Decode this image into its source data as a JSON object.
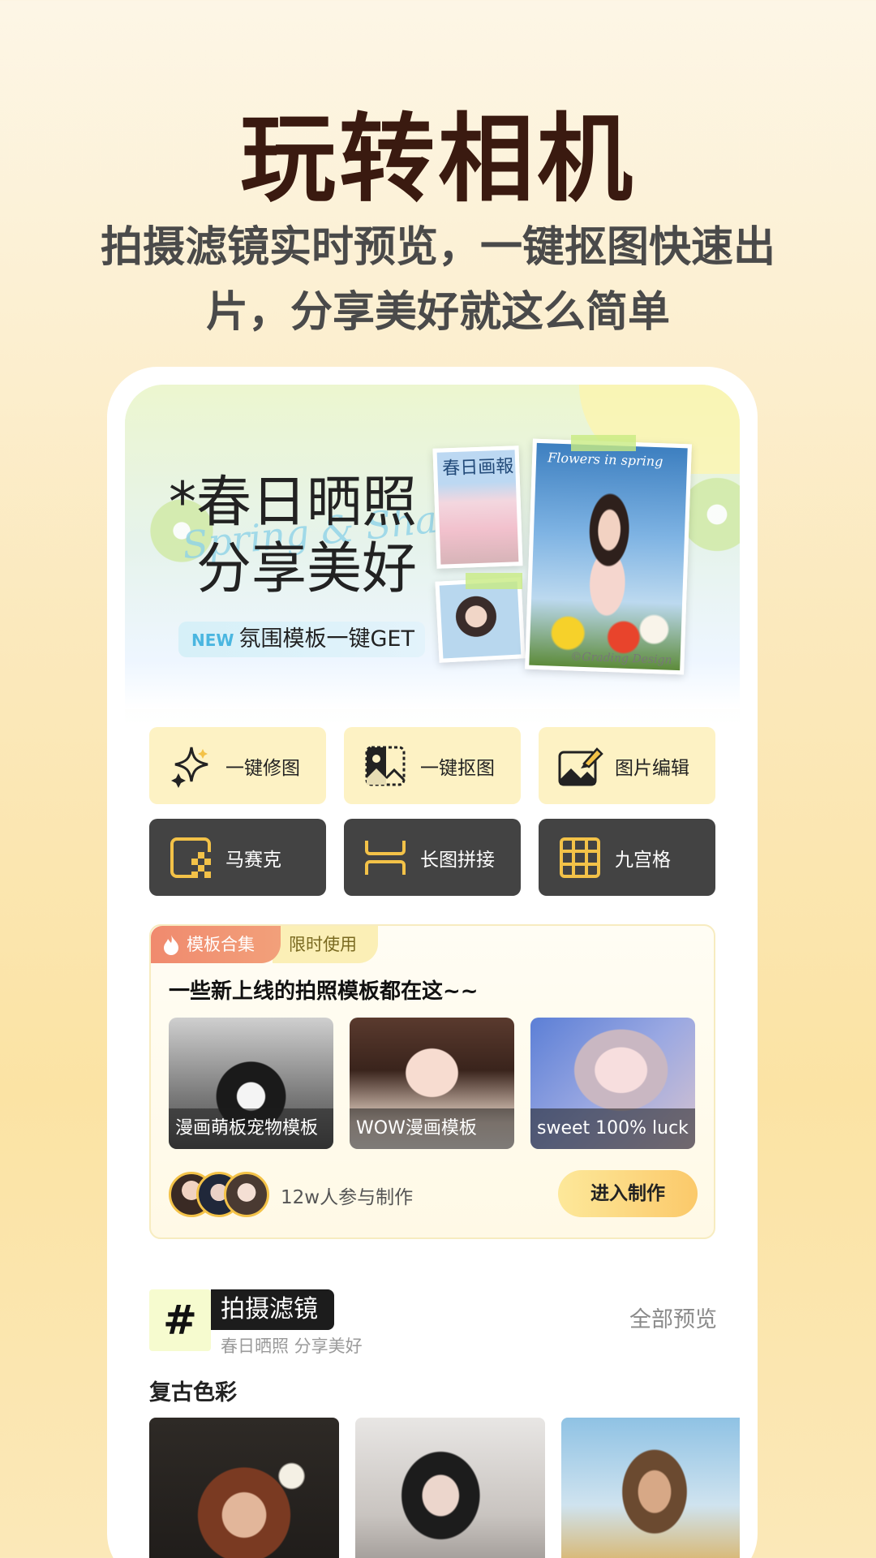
{
  "hero": {
    "title": "玩转相机",
    "subtitle": "拍摄滤镜实时预览，一键抠图快速出片，分享美好就这么简单"
  },
  "banner": {
    "headline_line1": "*春日晒照",
    "headline_line2": "分享美好",
    "script_text": "Spring & Sharing",
    "new_badge": "NEW",
    "pill_text": "氛围模板一键GET",
    "magazine_title": "春日画報",
    "photo_script": "Flowers in spring",
    "photo_credit": "©Grading Design"
  },
  "tools": [
    {
      "label": "一键修图",
      "icon": "sparkle-icon",
      "style": "light"
    },
    {
      "label": "一键抠图",
      "icon": "cutout-icon",
      "style": "light"
    },
    {
      "label": "图片编辑",
      "icon": "image-edit-icon",
      "style": "light"
    },
    {
      "label": "马赛克",
      "icon": "mosaic-icon",
      "style": "dark"
    },
    {
      "label": "长图拼接",
      "icon": "long-stitch-icon",
      "style": "dark"
    },
    {
      "label": "九宫格",
      "icon": "grid-icon",
      "style": "dark"
    }
  ],
  "templates": {
    "tag_primary": "模板合集",
    "tag_secondary": "限时使用",
    "heading": "一些新上线的拍照模板都在这~~",
    "items": [
      {
        "caption": "漫画萌板宠物模板"
      },
      {
        "caption": "WOW漫画模板"
      },
      {
        "caption": "sweet 100% luck"
      }
    ],
    "participants": "12w人参与制作",
    "enter_button": "进入制作"
  },
  "filters": {
    "title": "拍摄滤镜",
    "subtitle": "春日晒照 分享美好",
    "see_all": "全部预览",
    "category": "复古色彩"
  },
  "colors": {
    "accent_yellow": "#fbc96a",
    "tool_light_bg": "#fdf2c4",
    "tool_dark_bg": "#434343",
    "tag_red": "#f08a6e",
    "icon_yellow": "#f3c248"
  }
}
